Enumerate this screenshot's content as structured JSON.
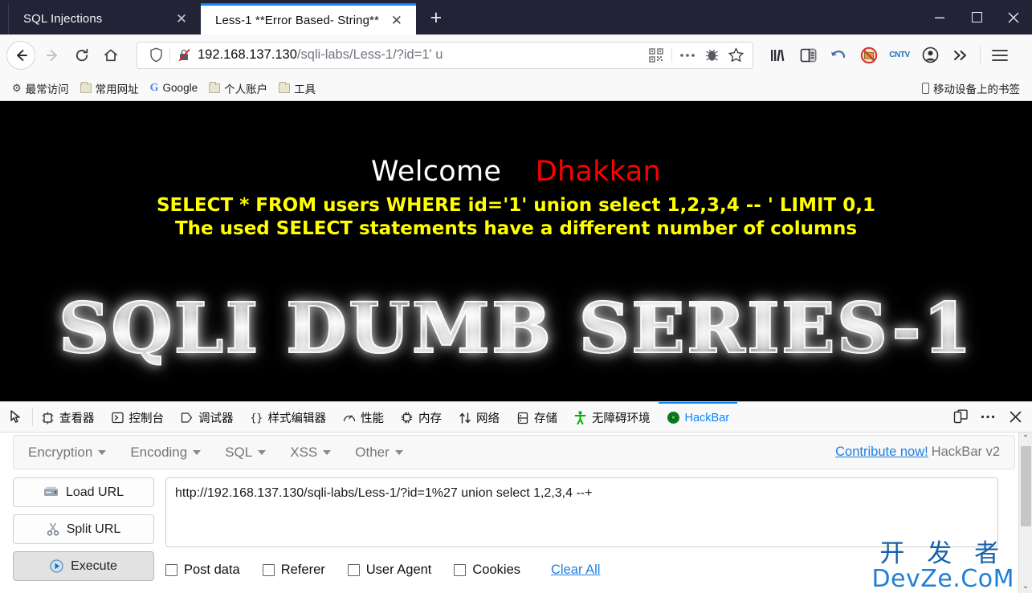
{
  "window": {
    "minimize_label": "—",
    "maximize_label": "□",
    "close_label": "✕"
  },
  "tabs": [
    {
      "label": "SQL Injections",
      "close": "✕",
      "active": false
    },
    {
      "label": "Less-1 **Error Based- String**",
      "close": "✕",
      "active": true
    }
  ],
  "newtab_label": "+",
  "nav": {
    "back_label": "←",
    "forward_label": "→",
    "reload_label": "⟳",
    "home_label": "⌂",
    "shield_icon": "shield-icon",
    "insecure_icon": "broken-lock-icon",
    "url_main": "192.168.137.130",
    "url_path": "/sqli-labs/Less-1/?id=1'",
    "url_tail": " u",
    "qr_icon": "qr-code-icon",
    "more_icon": "ellipsis-icon",
    "bug_icon": "bug-icon",
    "star_icon": "star-icon",
    "library_icon": "library-icon",
    "sidebar_icon": "sidebar-icon",
    "undo_icon": "undo-arrow-icon",
    "noscript_icon": "noscript-blocked-icon",
    "cntv_icon": "CNTV",
    "account_icon": "account-icon",
    "chevrons_icon": "double-chevron-icon",
    "menu_icon": "hamburger-menu-icon"
  },
  "bookmarks": [
    {
      "icon": "gear-icon",
      "label": "最常访问"
    },
    {
      "icon": "folder-icon",
      "label": "常用网址"
    },
    {
      "icon": "google-icon",
      "label": "Google"
    },
    {
      "icon": "folder-icon",
      "label": "个人账户"
    },
    {
      "icon": "folder-icon",
      "label": "工具"
    }
  ],
  "bookmarks_right": {
    "icon": "mobile-icon",
    "label": "移动设备上的书签"
  },
  "page": {
    "welcome": "Welcome",
    "username": "Dhakkan",
    "sql_line1": "SELECT * FROM users WHERE id='1' union select 1,2,3,4 -- ' LIMIT 0,1",
    "sql_line2": "The used SELECT statements have a different number of columns",
    "logo": "SQLI DUMB SERIES-1",
    "colors": {
      "background": "#000000",
      "welcome": "#ffffff",
      "username": "#ff0000",
      "sql": "#ffff00"
    }
  },
  "devtools": {
    "picker_icon": "element-picker-icon",
    "tabs": [
      {
        "icon": "inspector-icon",
        "label": "查看器",
        "active": false
      },
      {
        "icon": "console-icon",
        "label": "控制台",
        "active": false
      },
      {
        "icon": "debugger-icon",
        "label": "调试器",
        "active": false
      },
      {
        "icon": "style-editor-icon",
        "label": "样式编辑器",
        "active": false
      },
      {
        "icon": "performance-icon",
        "label": "性能",
        "active": false
      },
      {
        "icon": "memory-icon",
        "label": "内存",
        "active": false
      },
      {
        "icon": "network-icon",
        "label": "网络",
        "active": false
      },
      {
        "icon": "storage-icon",
        "label": "存储",
        "active": false
      },
      {
        "icon": "accessibility-icon",
        "label": "无障碍环境",
        "active": false
      },
      {
        "icon": "hackbar-icon",
        "label": "HackBar",
        "active": true
      }
    ],
    "responsive_icon": "responsive-design-mode-icon",
    "more_icon": "devtools-more-icon",
    "close_icon": "devtools-close-icon",
    "active_accent": "#0a84ff"
  },
  "hackbar": {
    "menu": [
      {
        "label": "Encryption"
      },
      {
        "label": "Encoding"
      },
      {
        "label": "SQL"
      },
      {
        "label": "XSS"
      },
      {
        "label": "Other"
      }
    ],
    "contribute_label": "Contribute now!",
    "version_label": "HackBar v2",
    "buttons": [
      {
        "icon": "load-url-icon",
        "label": "Load URL",
        "pressed": false
      },
      {
        "icon": "split-url-icon",
        "label": "Split URL",
        "pressed": false
      },
      {
        "icon": "execute-icon",
        "label": "Execute",
        "pressed": true
      }
    ],
    "url_value": "http://192.168.137.130/sqli-labs/Less-1/?id=1%27 union select 1,2,3,4 --+",
    "url_placeholder": "",
    "checkboxes": [
      {
        "label": "Post data",
        "checked": false
      },
      {
        "label": "Referer",
        "checked": false
      },
      {
        "label": "User Agent",
        "checked": false
      },
      {
        "label": "Cookies",
        "checked": false
      }
    ],
    "clear_all_label": "Clear All",
    "scroll_up_label": "⌃",
    "scroll_down_label": "⌄"
  },
  "watermark": {
    "line1": "开 发 者",
    "line2": "DevZe.CoM",
    "color": "#1661ab"
  }
}
